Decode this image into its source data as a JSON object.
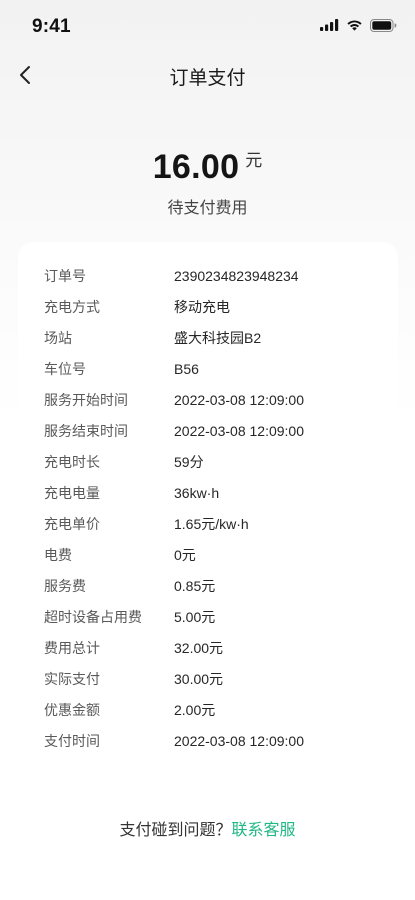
{
  "status_bar": {
    "time": "9:41",
    "icons": [
      "signal-icon",
      "wifi-icon",
      "battery-icon"
    ]
  },
  "nav": {
    "title": "订单支付",
    "back_icon": "chevron-left-icon"
  },
  "amount": {
    "value": "16.00",
    "unit": "元",
    "caption": "待支付费用"
  },
  "details": [
    {
      "label": "订单号",
      "value": "2390234823948234"
    },
    {
      "label": "充电方式",
      "value": "移动充电"
    },
    {
      "label": "场站",
      "value": "盛大科技园B2"
    },
    {
      "label": "车位号",
      "value": "B56"
    },
    {
      "label": "服务开始时间",
      "value": "2022-03-08 12:09:00"
    },
    {
      "label": "服务结束时间",
      "value": "2022-03-08 12:09:00"
    },
    {
      "label": "充电时长",
      "value": "59分"
    },
    {
      "label": "充电电量",
      "value": "36kw·h"
    },
    {
      "label": "充电单价",
      "value": "1.65元/kw·h"
    },
    {
      "label": "电费",
      "value": "0元"
    },
    {
      "label": "服务费",
      "value": "0.85元"
    },
    {
      "label": "超时设备占用费",
      "value": "5.00元"
    },
    {
      "label": "费用总计",
      "value": "32.00元"
    },
    {
      "label": "实际支付",
      "value": "30.00元"
    },
    {
      "label": "优惠金额",
      "value": "2.00元"
    },
    {
      "label": "支付时间",
      "value": "2022-03-08 12:09:00"
    }
  ],
  "help": {
    "text": "支付碰到问题？",
    "link": "联系客服"
  },
  "colors": {
    "accent": "#20b884",
    "text_primary": "#262626",
    "text_secondary": "#595959"
  }
}
